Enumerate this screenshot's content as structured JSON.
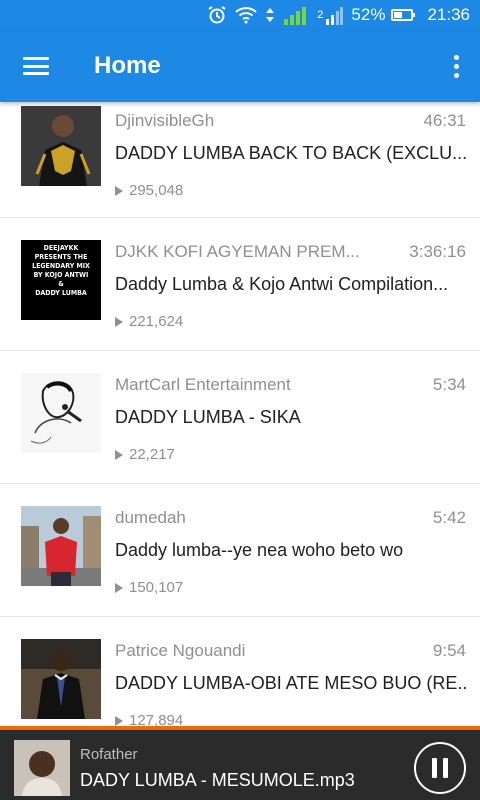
{
  "status": {
    "battery": "52%",
    "time": "21:36",
    "battery_level": 0.52,
    "signal": "2"
  },
  "appbar": {
    "title": "Home"
  },
  "videos": [
    {
      "channel": "DjinvisibleGh",
      "duration": "46:31",
      "title": "DADDY LUMBA BACK TO BACK (EXCLU...",
      "views": "295,048"
    },
    {
      "channel": "DJKK KOFI AGYEMAN PREM...",
      "duration": "3:36:16",
      "title": "Daddy Lumba & Kojo Antwi Compilation...",
      "views": "221,624",
      "thumb_text": [
        "DEEJAYKK",
        "PRESENTS THE",
        "LEGENDARY MIX",
        "BY KOJO ANTWI",
        "&",
        "DADDY LUMBA"
      ]
    },
    {
      "channel": "MartCarl Entertainment",
      "duration": "5:34",
      "title": "DADDY LUMBA - SIKA",
      "views": "22,217"
    },
    {
      "channel": "dumedah",
      "duration": "5:42",
      "title": "Daddy lumba--ye nea woho beto wo",
      "views": "150,107"
    },
    {
      "channel": "Patrice Ngouandi",
      "duration": "9:54",
      "title": "DADDY LUMBA-OBI ATE MESO BUO (RE...",
      "views": "127,894"
    }
  ],
  "player": {
    "channel": "Rofather",
    "title": "DADY LUMBA - MESUMOLE.mp3"
  },
  "colors": {
    "primary": "#1e88e5",
    "accent": "#ef6c00",
    "player_bg": "#2b2b2b"
  }
}
